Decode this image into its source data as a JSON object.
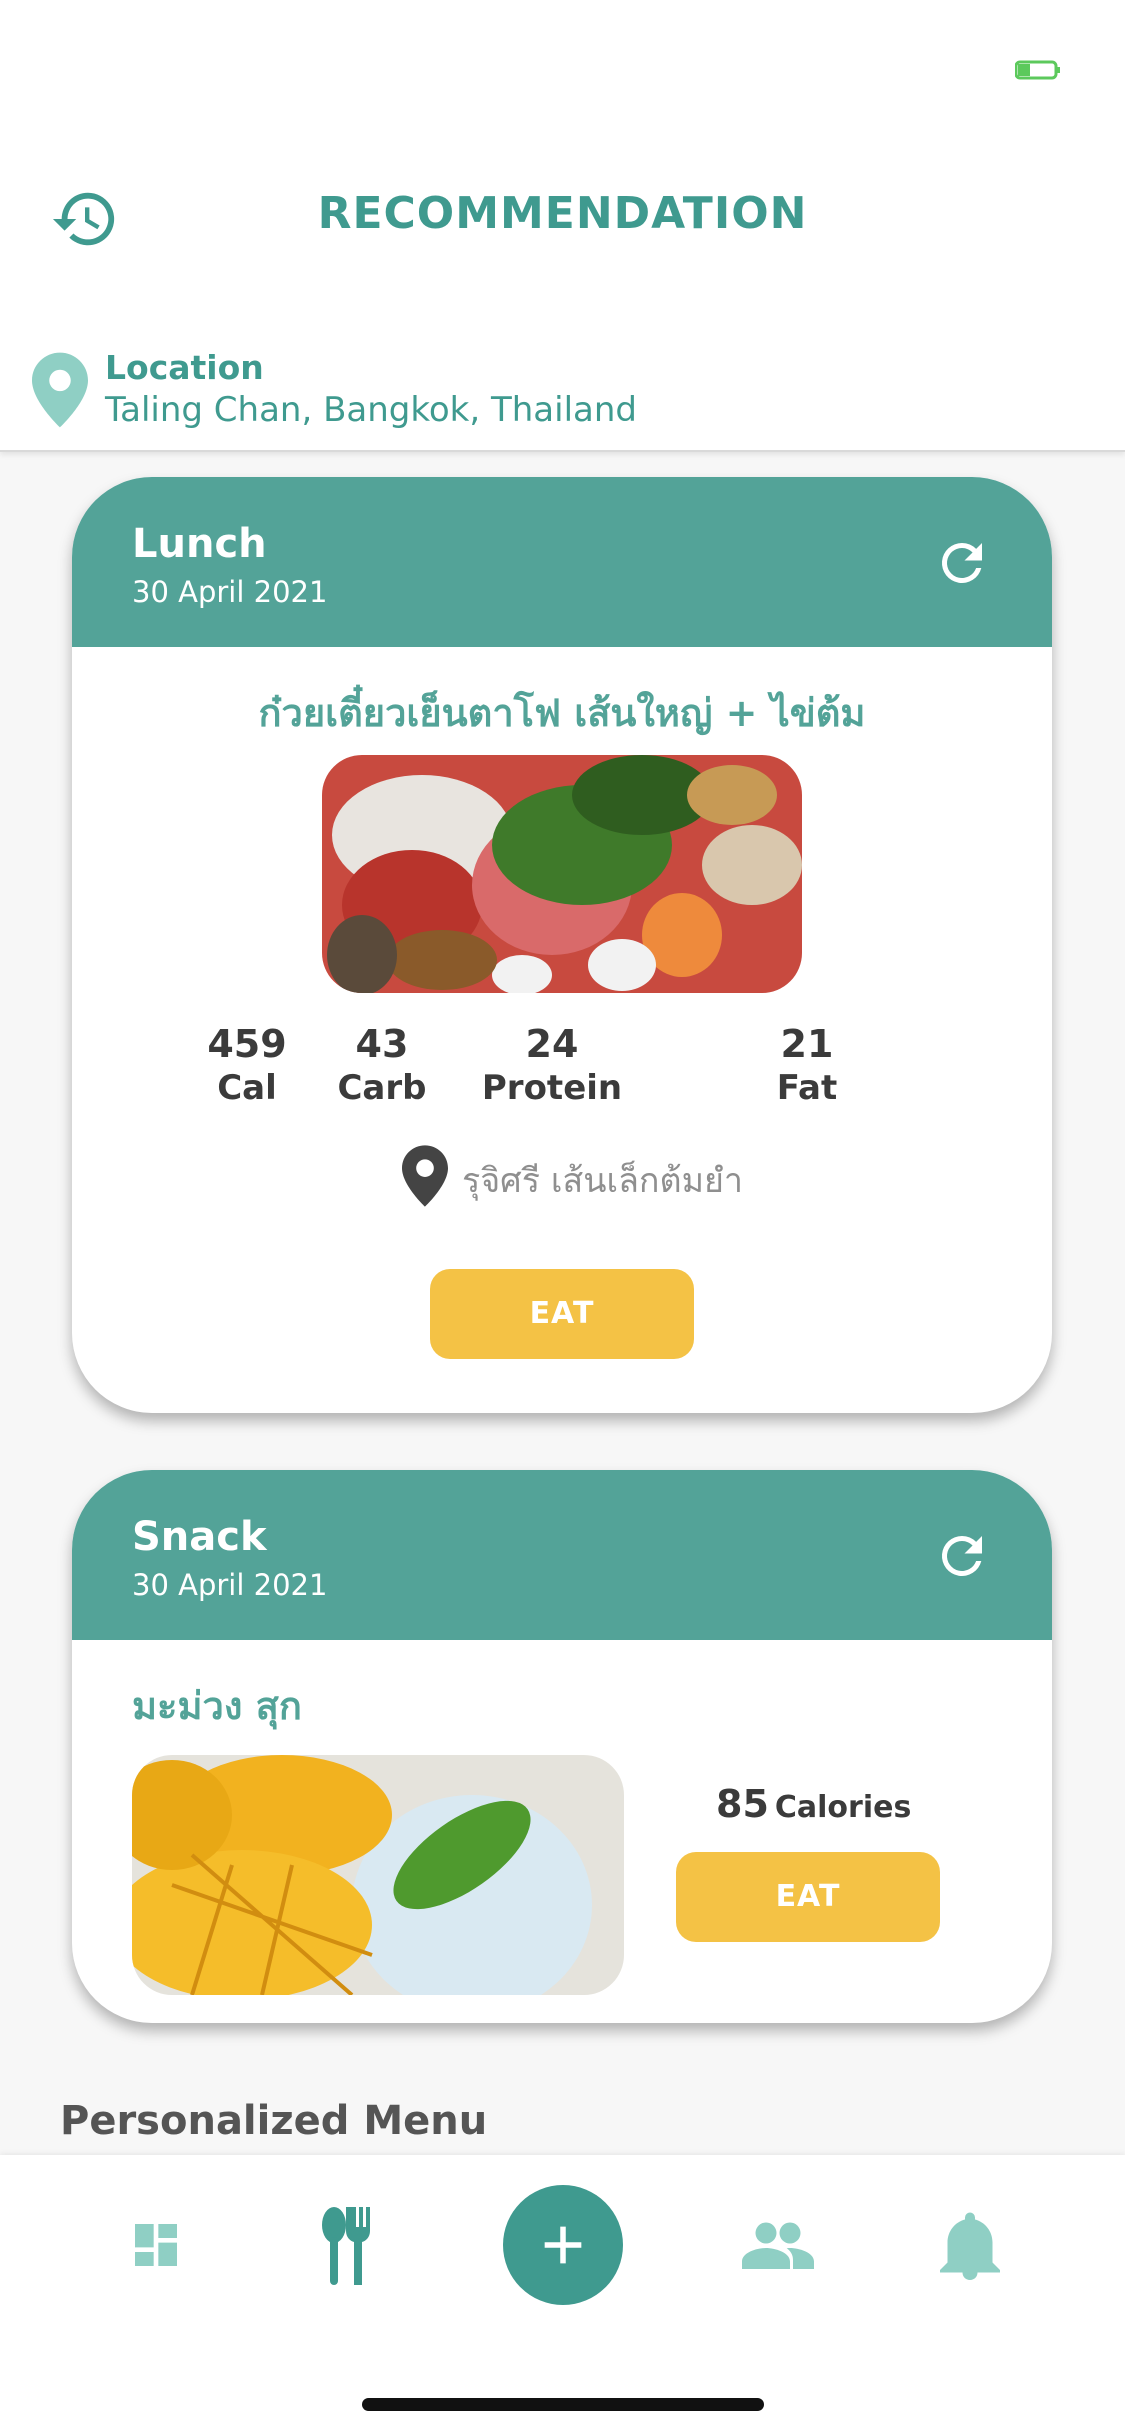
{
  "header": {
    "title": "RECOMMENDATION",
    "history_icon": "history-icon",
    "location": {
      "label": "Location",
      "value": "Taling Chan, Bangkok, Thailand",
      "icon": "map-pin-icon"
    }
  },
  "colors": {
    "primary": "#53a398",
    "title": "#3f9a8f",
    "accent": "#f4c245",
    "text_dark": "#3b3b3b"
  },
  "lunch": {
    "title": "Lunch",
    "date": "30 April 2021",
    "dish": "ก๋วยเตี๋ยวเย็นตาโฟ เส้นใหญ่ + ไข่ต้ม",
    "nutrition": [
      {
        "value": "459",
        "label": "Cal"
      },
      {
        "value": "43",
        "label": "Carb"
      },
      {
        "value": "24",
        "label": "Protein"
      },
      {
        "value": "21",
        "label": "Fat"
      }
    ],
    "place": "รุจิศรี เส้นเล็กต้มยำ",
    "eat_label": "EAT"
  },
  "snack": {
    "title": "Snack",
    "date": "30 April 2021",
    "dish": "มะม่วง สุก",
    "calories_value": "85",
    "calories_unit": "Calories",
    "eat_label": "EAT"
  },
  "personalized": {
    "title": "Personalized Menu"
  },
  "tabbar": {
    "items": [
      {
        "icon": "dashboard-icon"
      },
      {
        "icon": "fork-knife-icon"
      },
      {
        "icon": "add-icon"
      },
      {
        "icon": "people-icon"
      },
      {
        "icon": "bell-icon"
      }
    ]
  }
}
